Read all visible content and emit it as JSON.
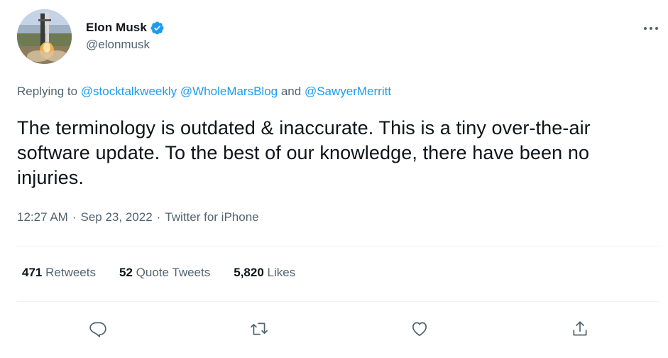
{
  "author": {
    "display_name": "Elon Musk",
    "handle": "@elonmusk",
    "avatar_icon": "rocket-launch-avatar",
    "verified_icon": "verified-badge-icon",
    "verified_color": "#1d9bf0"
  },
  "more_icon": "more-horizontal-icon",
  "replying": {
    "prefix": "Replying to ",
    "mention1": "@stocktalkweekly",
    "mention2": "@WholeMarsBlog",
    "conjunction": " and ",
    "mention3": "@SawyerMerritt"
  },
  "tweet": {
    "text": "The terminology is outdated & inaccurate. This is a tiny over-the-air software update. To the best of our knowledge, there have been no injuries."
  },
  "meta": {
    "time": "12:27 AM",
    "separator": "·",
    "date": "Sep 23, 2022",
    "source": "Twitter for iPhone"
  },
  "stats": {
    "retweets_count": "471",
    "retweets_label": "Retweets",
    "quotes_count": "52",
    "quotes_label": "Quote Tweets",
    "likes_count": "5,820",
    "likes_label": "Likes"
  },
  "actions": {
    "reply_icon": "reply-icon",
    "retweet_icon": "retweet-icon",
    "like_icon": "heart-icon",
    "share_icon": "share-icon"
  },
  "colors": {
    "text_primary": "#0f1419",
    "text_secondary": "#536471",
    "link": "#1d9bf0",
    "divider": "#eff3f4"
  }
}
